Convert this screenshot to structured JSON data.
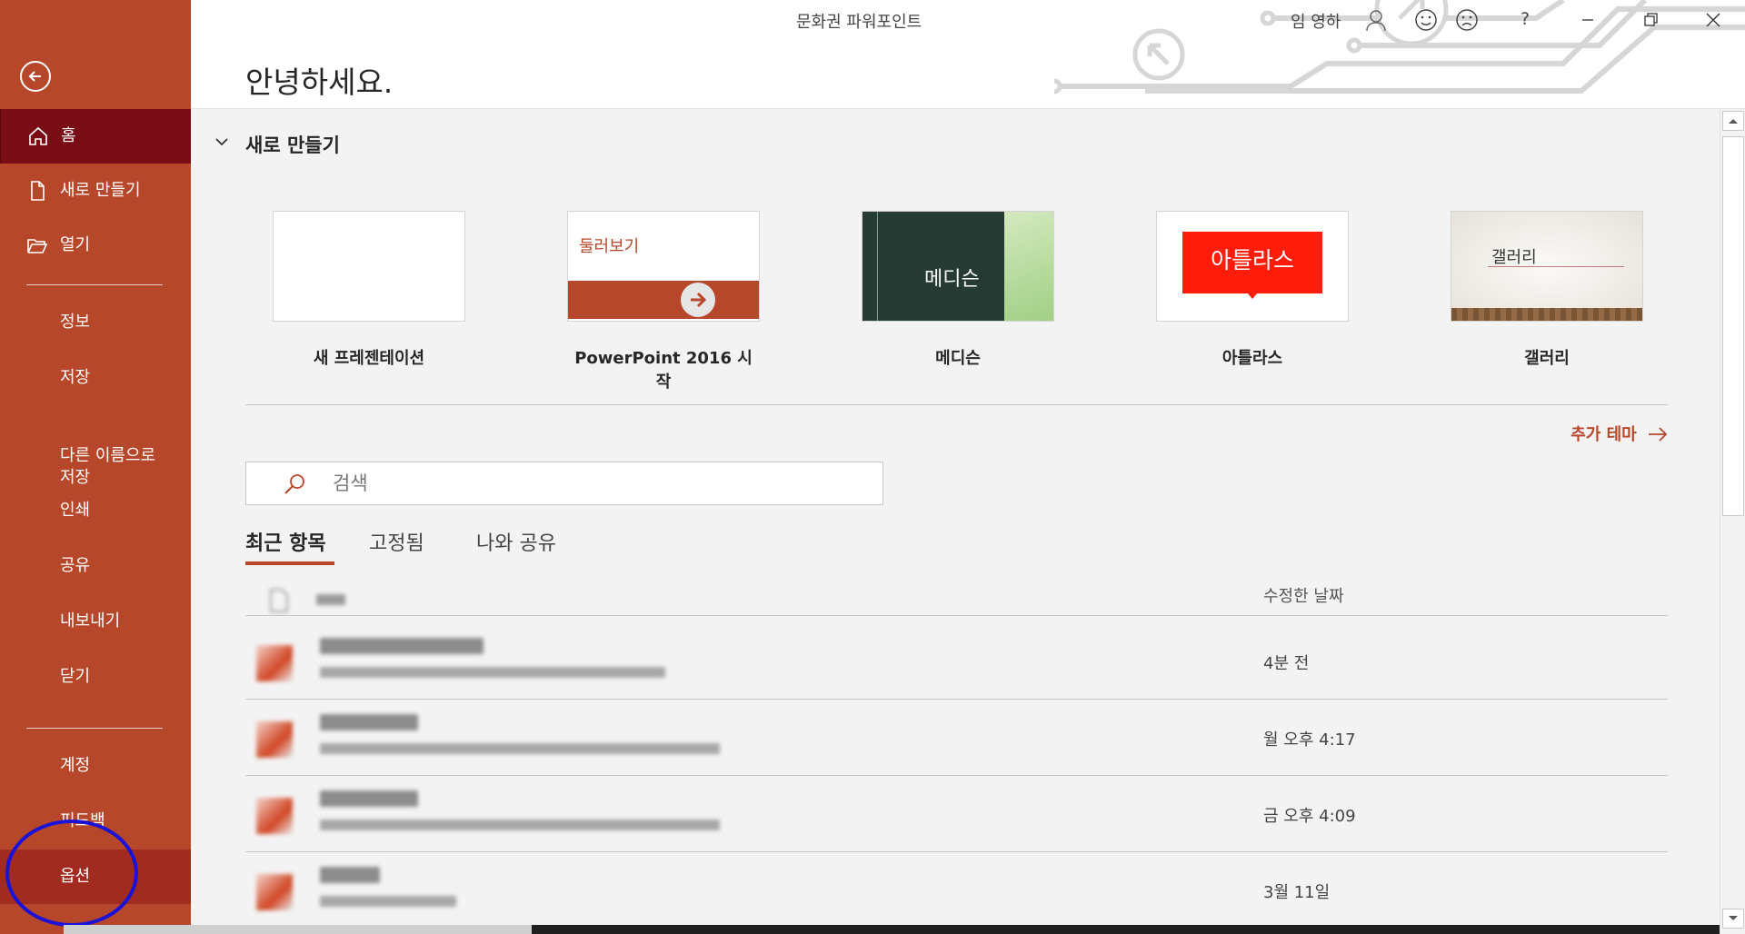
{
  "window": {
    "app_title": "문화권 파워포인트",
    "user_name": "임 영하",
    "help_label": "?"
  },
  "sidebar": {
    "items": [
      {
        "label": "홈"
      },
      {
        "label": "새로 만들기"
      },
      {
        "label": "열기"
      },
      {
        "label": "정보"
      },
      {
        "label": "저장"
      },
      {
        "label": "다른 이름으로\n저장"
      },
      {
        "label": "인쇄"
      },
      {
        "label": "공유"
      },
      {
        "label": "내보내기"
      },
      {
        "label": "닫기"
      },
      {
        "label": "계정"
      },
      {
        "label": "피드백"
      },
      {
        "label": "옵션"
      }
    ]
  },
  "header": {
    "greeting": "안녕하세요."
  },
  "new_section": {
    "title": "새로 만들기",
    "templates": [
      {
        "name": "새 프레젠테이션",
        "thumb_text": ""
      },
      {
        "name": "PowerPoint 2016 시작",
        "thumb_text": "둘러보기"
      },
      {
        "name": "메디슨",
        "thumb_text": "메디슨"
      },
      {
        "name": "아틀라스",
        "thumb_text": "아틀라스"
      },
      {
        "name": "갤러리",
        "thumb_text": "갤러리"
      }
    ],
    "more_themes": "추가 테마"
  },
  "search": {
    "placeholder": "검색"
  },
  "tabs": [
    {
      "label": "최근 항목"
    },
    {
      "label": "고정됨"
    },
    {
      "label": "나와 공유"
    }
  ],
  "recent": {
    "col_date": "수정한 날짜",
    "rows": [
      {
        "date": "4분 전"
      },
      {
        "date": "월 오후 4:17"
      },
      {
        "date": "금 오후 4:09"
      },
      {
        "date": "3월 11일"
      }
    ]
  },
  "colors": {
    "accent": "#b7472a",
    "active_nav": "#7a0c16",
    "annotation": "#1a12d6"
  }
}
